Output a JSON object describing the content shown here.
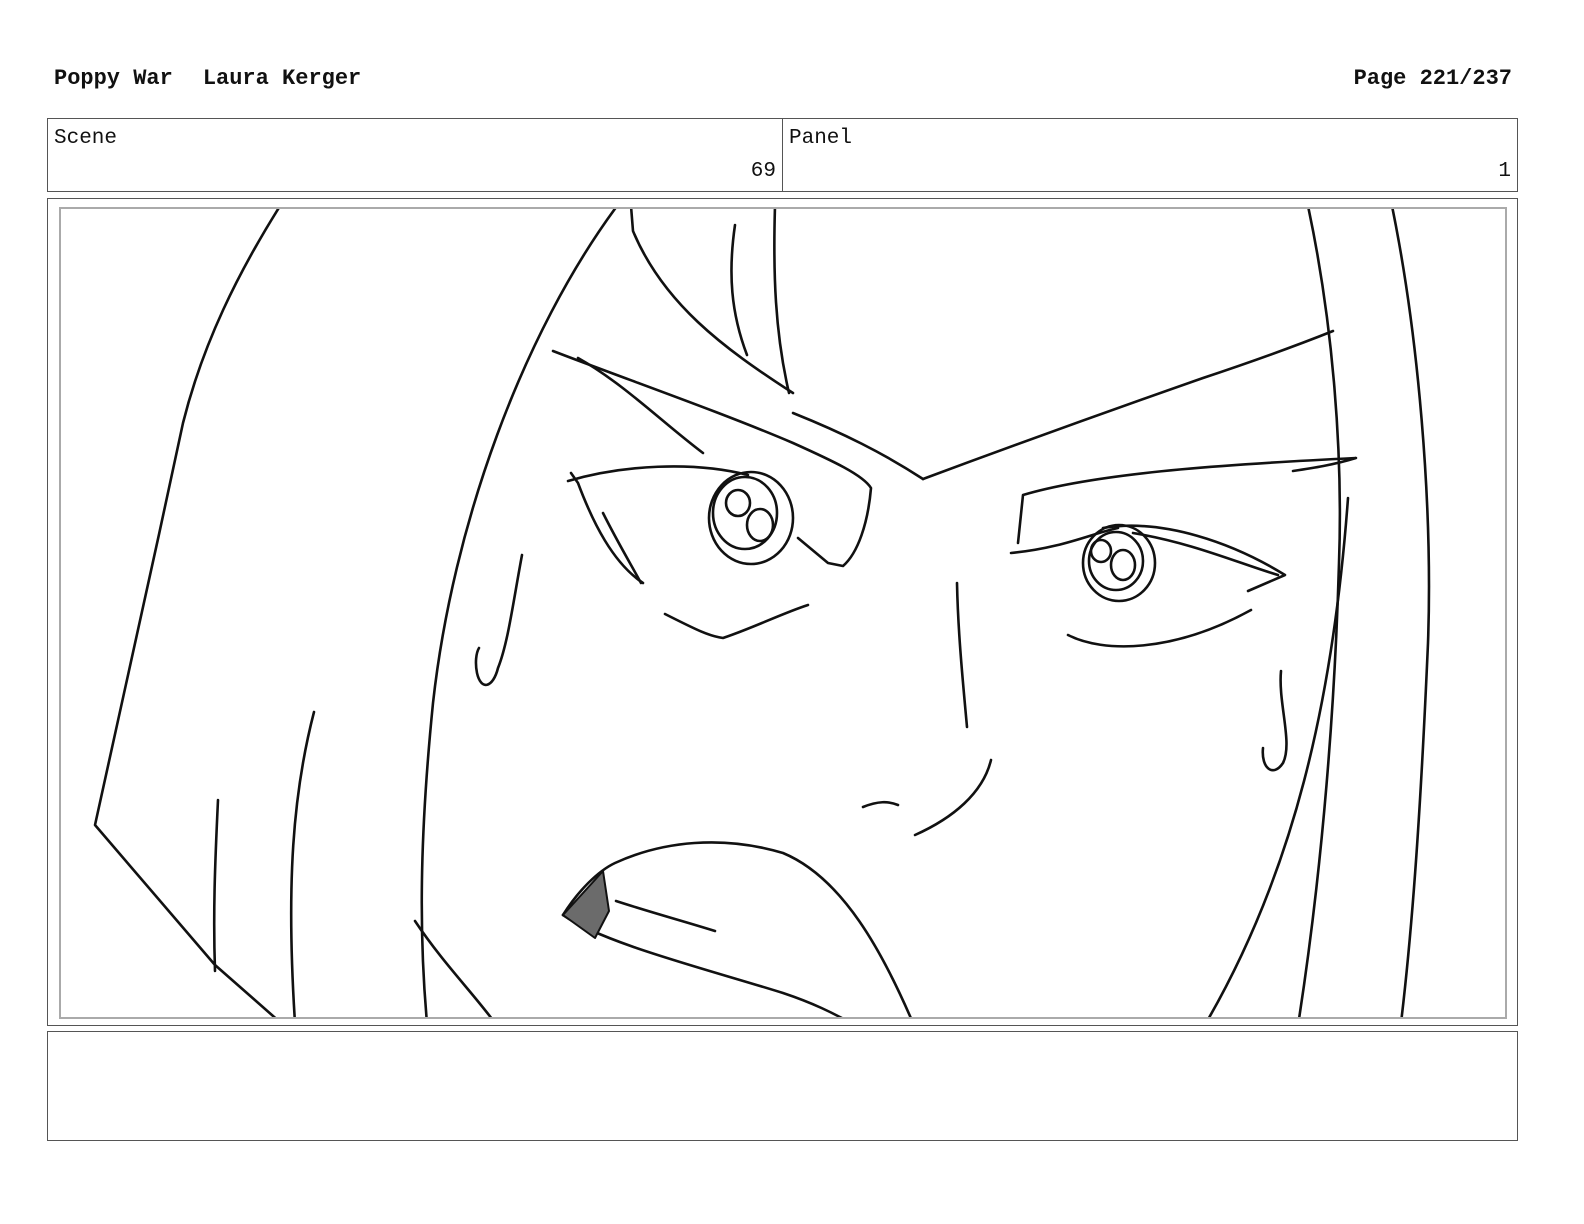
{
  "header": {
    "project": "Poppy War",
    "artist": "Laura Kerger",
    "page": "Page 221/237"
  },
  "info": {
    "scene_label": "Scene",
    "scene_value": "69",
    "panel_label": "Panel",
    "panel_value": "1"
  },
  "notes": {
    "text": ""
  },
  "drawing": {
    "subject": "face-closeup-sketch",
    "stroke_color": "#111111",
    "mouth_fill_color": "#6b6b6b"
  }
}
